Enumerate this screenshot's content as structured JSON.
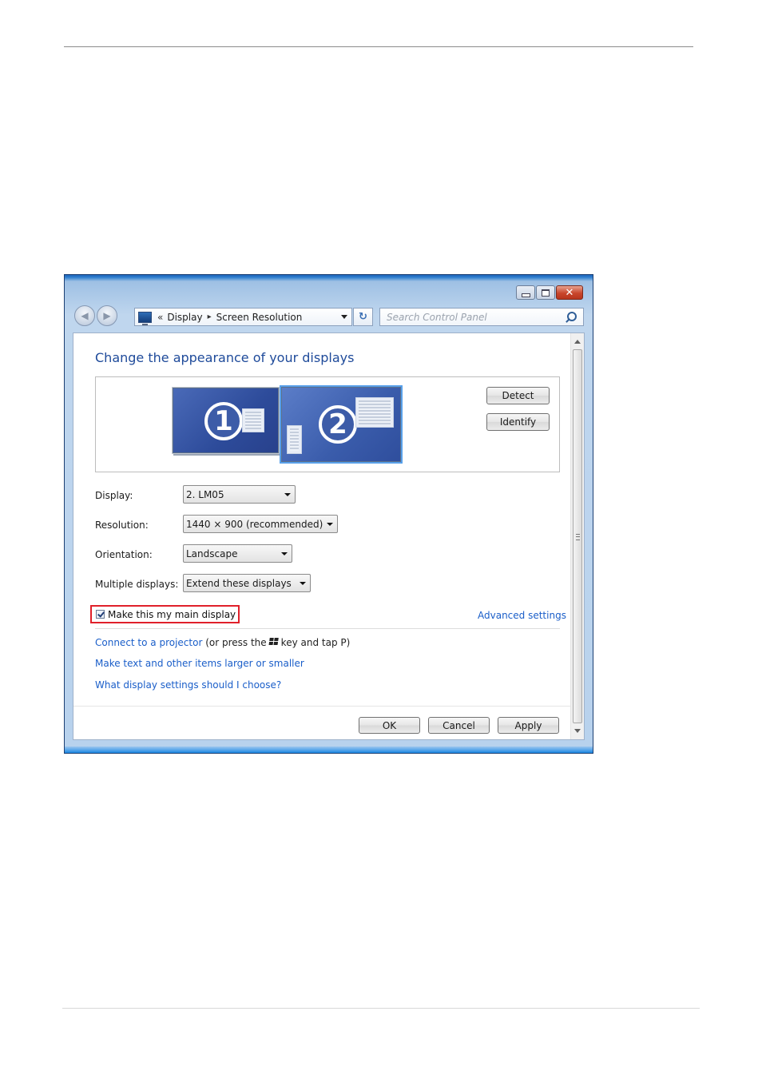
{
  "window": {
    "caption_buttons": {
      "minimize": "minimize-icon",
      "maximize": "maximize-icon",
      "close": "close-icon"
    },
    "nav": {
      "back": "◀",
      "forward": "▶"
    },
    "address": {
      "overflow": "«",
      "crumbs": [
        "Display",
        "Screen Resolution"
      ],
      "separator": "▸"
    },
    "refresh_glyph": "↻",
    "search": {
      "placeholder": "Search Control Panel"
    }
  },
  "content": {
    "heading": "Change the appearance of your displays",
    "monitors": [
      {
        "number": "1"
      },
      {
        "number": "2"
      }
    ],
    "detect_label": "Detect",
    "identify_label": "Identify",
    "fields": {
      "display": {
        "label": "Display:",
        "value": "2. LM05"
      },
      "resolution": {
        "label": "Resolution:",
        "value": "1440 × 900 (recommended)"
      },
      "orientation": {
        "label": "Orientation:",
        "value": "Landscape"
      },
      "multiple": {
        "label": "Multiple displays:",
        "value": "Extend these displays"
      }
    },
    "main_display_label": "Make this my main display",
    "main_display_checked": true,
    "advanced_settings": "Advanced settings",
    "projector": {
      "link": "Connect to a projector",
      "text_before": "(or press the",
      "text_after": "key and tap P)"
    },
    "links": {
      "text_size": "Make text and other items larger or smaller",
      "which_settings": "What display settings should I choose?"
    },
    "footer": {
      "ok": "OK",
      "cancel": "Cancel",
      "apply": "Apply"
    }
  },
  "colors": {
    "link": "#1a5ec9",
    "heading": "#1e4a9a",
    "highlight_border": "#e0202a",
    "selected_monitor": "#58a0ea"
  }
}
